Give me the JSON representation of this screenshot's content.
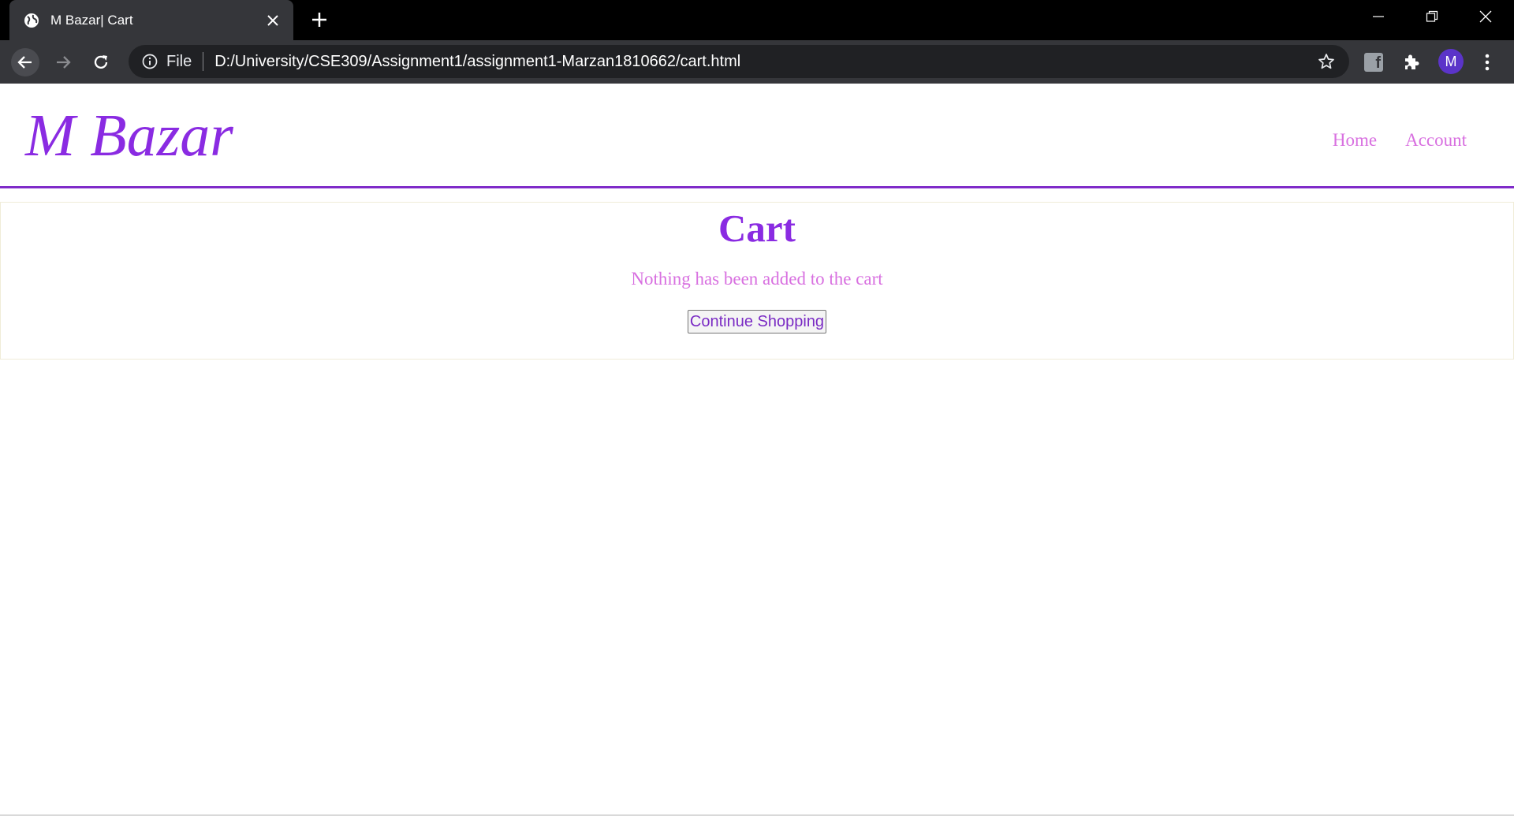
{
  "browser": {
    "tab": {
      "title": "M Bazar| Cart"
    },
    "address_bar": {
      "scheme_label": "File",
      "url": "D:/University/CSE309/Assignment1/assignment1-Marzan1810662/cart.html"
    },
    "profile": {
      "initial": "M"
    },
    "extension": {
      "label": "f"
    }
  },
  "site": {
    "logo": "M Bazar",
    "nav": {
      "home": "Home",
      "account": "Account"
    }
  },
  "cart": {
    "title": "Cart",
    "message": "Nothing has been added to the cart",
    "button_label": "Continue Shopping"
  },
  "colors": {
    "brand_purple": "#8a2be2",
    "link_pink": "#d870e0",
    "chrome_dark": "#35363a"
  }
}
